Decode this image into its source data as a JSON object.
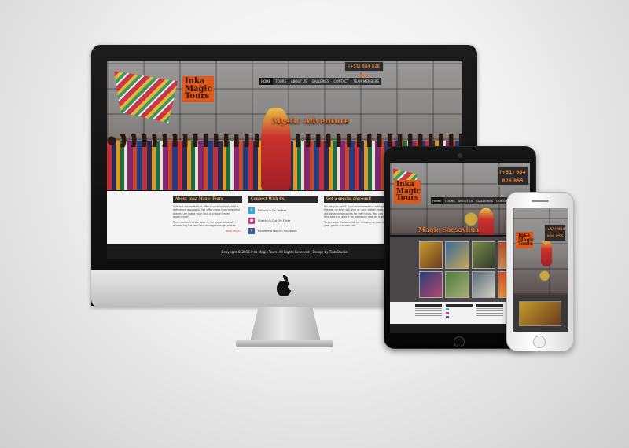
{
  "site": {
    "logo_line1": "Inka",
    "logo_line2": "Magic",
    "logo_line3": "Tours",
    "phone": "(+51) 984 826 855",
    "phone_short_1": "(+51) 984",
    "phone_short_2": "826 855",
    "nav": [
      "HOME",
      "TOURS",
      "ABOUT US",
      "GALLERIES",
      "CONTACT",
      "TEAM MEMBERS"
    ],
    "nav_tablet": [
      "HOME",
      "TOURS",
      "ABOUT US",
      "GALLERIES",
      "CONTACT",
      "TE"
    ],
    "headline_desktop": "Mystic Adventure",
    "headline_tablet": "Magic Sacsayhua",
    "footer": "Copyright © 2016 Inka Magic Tours. All Rights Reserved | Design by TintaStudio"
  },
  "columns": {
    "about": {
      "title": "About Inka Magic Tours",
      "p1": "\"We are committed to offer tourist options with a difference approach. We offer more than beautiful places, we make your visit a unique travel experience\".",
      "p2": "The intention of our tour is the experience of contacting the real Inka energy through places.",
      "more": "Read More..."
    },
    "connect": {
      "title": "Connect With Us",
      "items": [
        "Follow Us On Twitter",
        "Check Us Out On Flickr",
        "Become a Fan On Facebook"
      ]
    },
    "discount": {
      "title": "Get a special discount!",
      "p1": "It's easy to get it. Just recommend us with your friends, so they will give at your visitor code, you will be winning points for free tours. You can this free tours or give it for someone else as a gift card.",
      "p2": "To get your visitor code for this promo just contact your guide and ask him."
    }
  },
  "colors": {
    "accent_orange": "#e0591c",
    "headline_orange": "#e8742c",
    "column_title": "#f0b25a",
    "twitter": "#3aa7d8",
    "flickr": "#d8378f",
    "facebook": "#3b5a98"
  },
  "icons": [
    "apple-logo-icon",
    "twitter-icon",
    "flickr-icon",
    "facebook-icon"
  ]
}
